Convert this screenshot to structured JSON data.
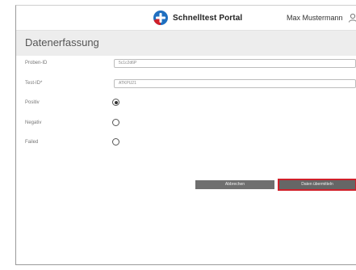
{
  "header": {
    "title": "Schnelltest Portal",
    "user_name": "Max Mustermann"
  },
  "section": {
    "title": "Datenerfassung"
  },
  "form": {
    "fields": [
      {
        "label": "Proben-ID",
        "value": "5c1c2d6P"
      },
      {
        "label": "Test-ID*",
        "value": "ATKPU21"
      }
    ],
    "radios": [
      {
        "label": "Positiv",
        "checked": true
      },
      {
        "label": "Negativ",
        "checked": false
      },
      {
        "label": "Failed",
        "checked": false
      }
    ]
  },
  "buttons": {
    "cancel_label": "Abbrechen",
    "submit_label": "Daten übermitteln"
  },
  "colors": {
    "accent_highlight": "#d0202a",
    "logo_blue": "#1f6fc0",
    "logo_red": "#d0202a",
    "section_bg": "#ededed",
    "button_bg": "#6f6f6f"
  },
  "icons": {
    "logo": "portal-logo-icon",
    "user": "user-icon"
  }
}
